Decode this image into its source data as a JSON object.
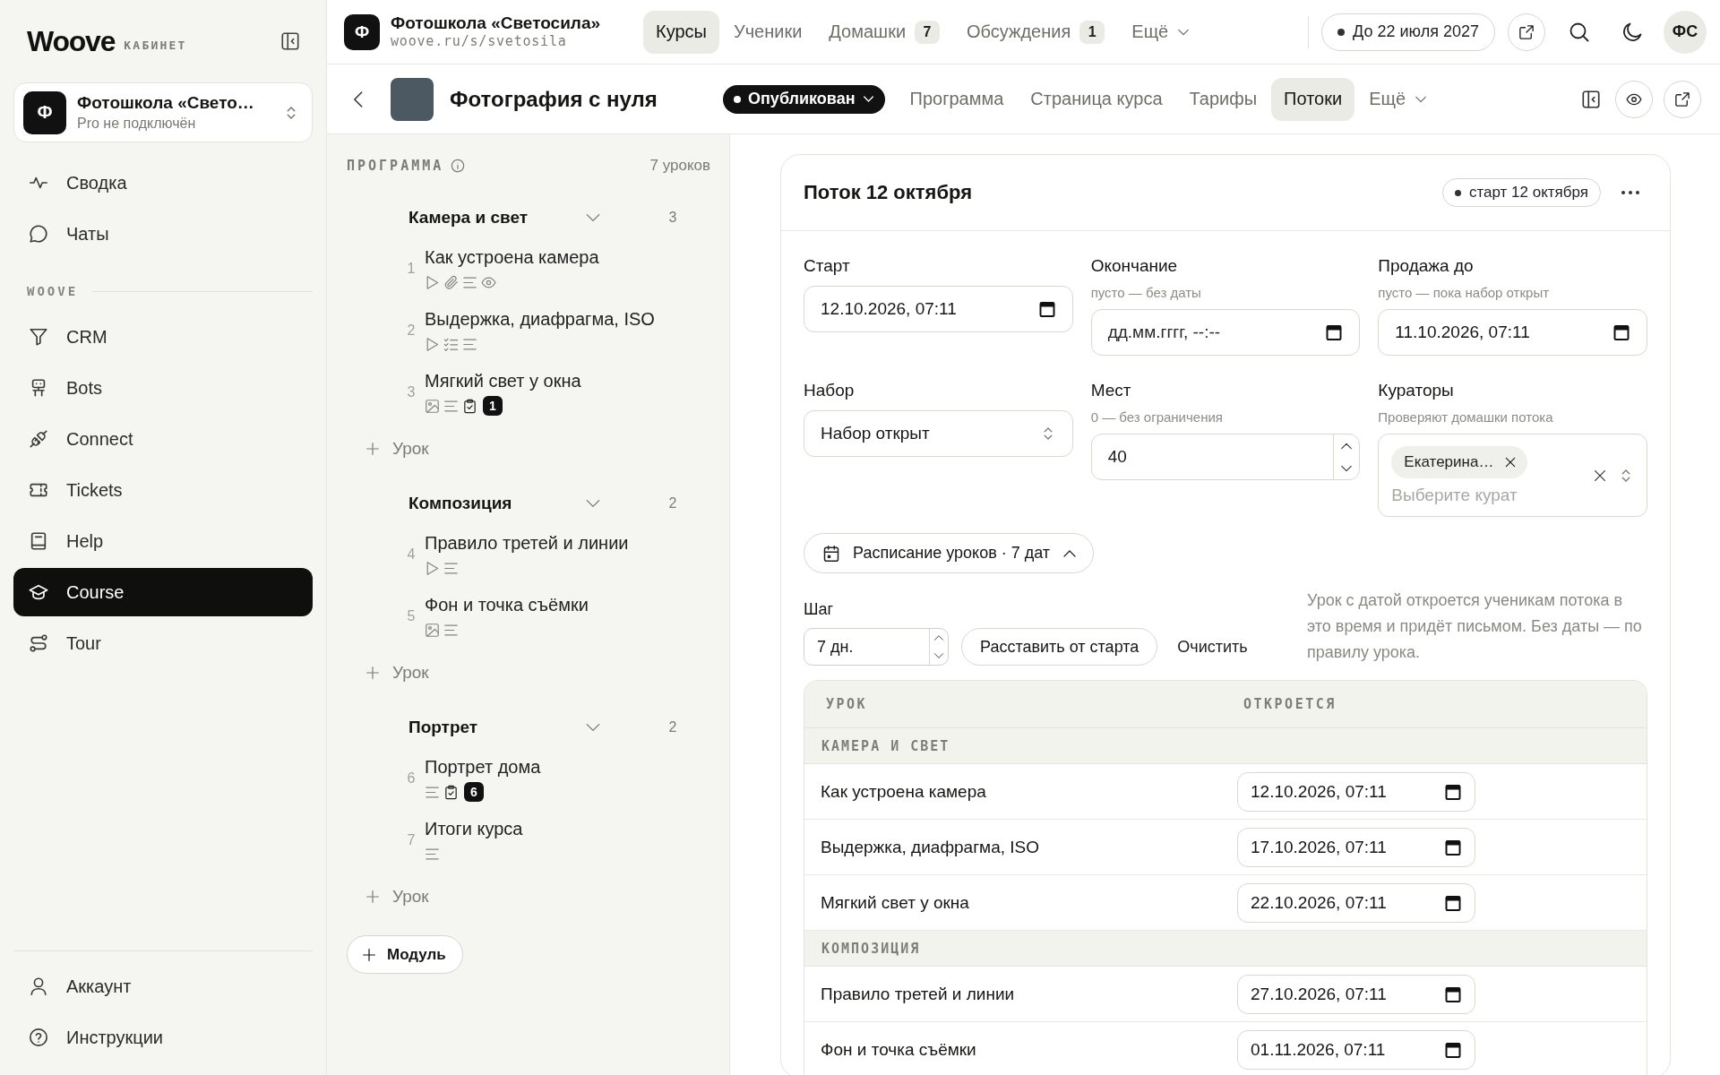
{
  "sidebar": {
    "brand": "Woove",
    "brand_caption": "КАБИНЕТ",
    "workspace": {
      "initial": "Ф",
      "name": "Фотошкола «Свето…",
      "plan": "Pro не подключён"
    },
    "nav": [
      {
        "label": "Сводка",
        "selected": false
      },
      {
        "label": "Чаты",
        "selected": false
      }
    ],
    "section": {
      "title": "WOOVE",
      "items": [
        {
          "label": "CRM",
          "selected": false
        },
        {
          "label": "Bots",
          "selected": false
        },
        {
          "label": "Connect",
          "selected": false
        },
        {
          "label": "Tickets",
          "selected": false
        },
        {
          "label": "Help",
          "selected": false
        },
        {
          "label": "Course",
          "selected": true
        },
        {
          "label": "Tour",
          "selected": false
        }
      ]
    },
    "footer": [
      {
        "label": "Аккаунт",
        "selected": false
      },
      {
        "label": "Инструкции",
        "selected": false
      }
    ]
  },
  "topbar": {
    "school": {
      "initial": "Ф",
      "name": "Фотошкола «Светосила»",
      "url": "woove.ru/s/svetosila"
    },
    "tabs": [
      {
        "kind": "tab",
        "label": "Курсы",
        "selected": true
      },
      {
        "kind": "tab",
        "label": "Ученики",
        "selected": false
      },
      {
        "kind": "tab",
        "label": "Домашки",
        "count": "7",
        "selected": false
      },
      {
        "kind": "tab",
        "label": "Обсуждения",
        "count": "1",
        "selected": false
      },
      {
        "kind": "menu",
        "label": "Ещё",
        "selected": false
      }
    ],
    "plan_badge": "До 22 июля 2027",
    "user_initials": "ФС"
  },
  "course": {
    "title": "Фотография с нуля",
    "status": "Опубликован",
    "tabs": [
      {
        "kind": "tab",
        "label": "Программа",
        "selected": false
      },
      {
        "kind": "tab",
        "label": "Страница курса",
        "selected": false
      },
      {
        "kind": "tab",
        "label": "Тарифы",
        "selected": false
      },
      {
        "kind": "tab",
        "label": "Потоки",
        "selected": true
      },
      {
        "kind": "menu",
        "label": "Ещё",
        "selected": false
      }
    ]
  },
  "program": {
    "heading": "ПРОГРАММА",
    "lesson_count": "7 уроков",
    "modules": [
      {
        "title": "Камера и свет",
        "count": "3",
        "expanded": true,
        "lessons": [
          {
            "number": "1",
            "title": "Как устроена камера",
            "materials": [
              {
                "kind": "video"
              },
              {
                "kind": "file"
              },
              {
                "kind": "text"
              },
              {
                "kind": "preview"
              }
            ]
          },
          {
            "number": "2",
            "title": "Выдержка, диафрагма, ISO",
            "materials": [
              {
                "kind": "video"
              },
              {
                "kind": "quiz"
              },
              {
                "kind": "text"
              }
            ]
          },
          {
            "number": "3",
            "title": "Мягкий свет у окна",
            "materials": [
              {
                "kind": "image"
              },
              {
                "kind": "text"
              },
              {
                "kind": "homework",
                "count": "1"
              }
            ]
          }
        ],
        "add_lesson": "Урок"
      },
      {
        "title": "Композиция",
        "count": "2",
        "expanded": true,
        "lessons": [
          {
            "number": "4",
            "title": "Правило третей и линии",
            "materials": [
              {
                "kind": "video"
              },
              {
                "kind": "text"
              }
            ]
          },
          {
            "number": "5",
            "title": "Фон и точка съёмки",
            "materials": [
              {
                "kind": "image"
              },
              {
                "kind": "text"
              }
            ]
          }
        ],
        "add_lesson": "Урок"
      },
      {
        "title": "Портрет",
        "count": "2",
        "expanded": true,
        "lessons": [
          {
            "number": "6",
            "title": "Портрет дома",
            "materials": [
              {
                "kind": "text"
              },
              {
                "kind": "homework",
                "count": "6"
              }
            ]
          },
          {
            "number": "7",
            "title": "Итоги курса",
            "materials": [
              {
                "kind": "text"
              }
            ]
          }
        ],
        "add_lesson": "Урок"
      }
    ],
    "add_module": "Модуль"
  },
  "stream": {
    "title": "Поток 12 октября",
    "badge": "старт 12 октября",
    "fields": [
      {
        "kind": "date",
        "label": "Старт",
        "value": "12.10.2026, 07:11"
      },
      {
        "kind": "date",
        "label": "Окончание",
        "hint": "пусто — без даты",
        "placeholder": "дд.мм.гггг, --:--"
      },
      {
        "kind": "date",
        "label": "Продажа до",
        "hint": "пусто — пока набор открыт",
        "value": "11.10.2026, 07:11"
      },
      {
        "kind": "select",
        "label": "Набор",
        "value": "Набор открыт"
      },
      {
        "kind": "number",
        "label": "Мест",
        "hint": "0 — без ограничения",
        "value": "40"
      },
      {
        "kind": "multiselect",
        "label": "Кураторы",
        "hint": "Проверяют домашки потока",
        "chips": [
          "Екатерина…"
        ],
        "placeholder": "Выберите курат"
      }
    ],
    "schedule": {
      "label": "Расписание уроков · 7 дат",
      "expanded": true,
      "step": {
        "label": "Шаг",
        "value": "7 дн."
      },
      "apply": "Расставить от старта",
      "clear": "Очистить",
      "note": "Урок с датой откроется ученикам потока в это время и придёт письмом. Без даты — по правилу урока.",
      "table": {
        "columns": [
          "УРОК",
          "ОТКРОЕТСЯ"
        ],
        "groups": [
          {
            "title": "КАМЕРА И СВЕТ",
            "rows": [
              {
                "lesson": "Как устроена камера",
                "opens": "12.10.2026, 07:11"
              },
              {
                "lesson": "Выдержка, диафрагма, ISO",
                "opens": "17.10.2026, 07:11"
              },
              {
                "lesson": "Мягкий свет у окна",
                "opens": "22.10.2026, 07:11"
              }
            ]
          },
          {
            "title": "КОМПОЗИЦИЯ",
            "rows": [
              {
                "lesson": "Правило третей и линии",
                "opens": "27.10.2026, 07:11"
              },
              {
                "lesson": "Фон и точка съёмки",
                "opens": "01.11.2026, 07:11"
              }
            ]
          }
        ]
      }
    }
  }
}
